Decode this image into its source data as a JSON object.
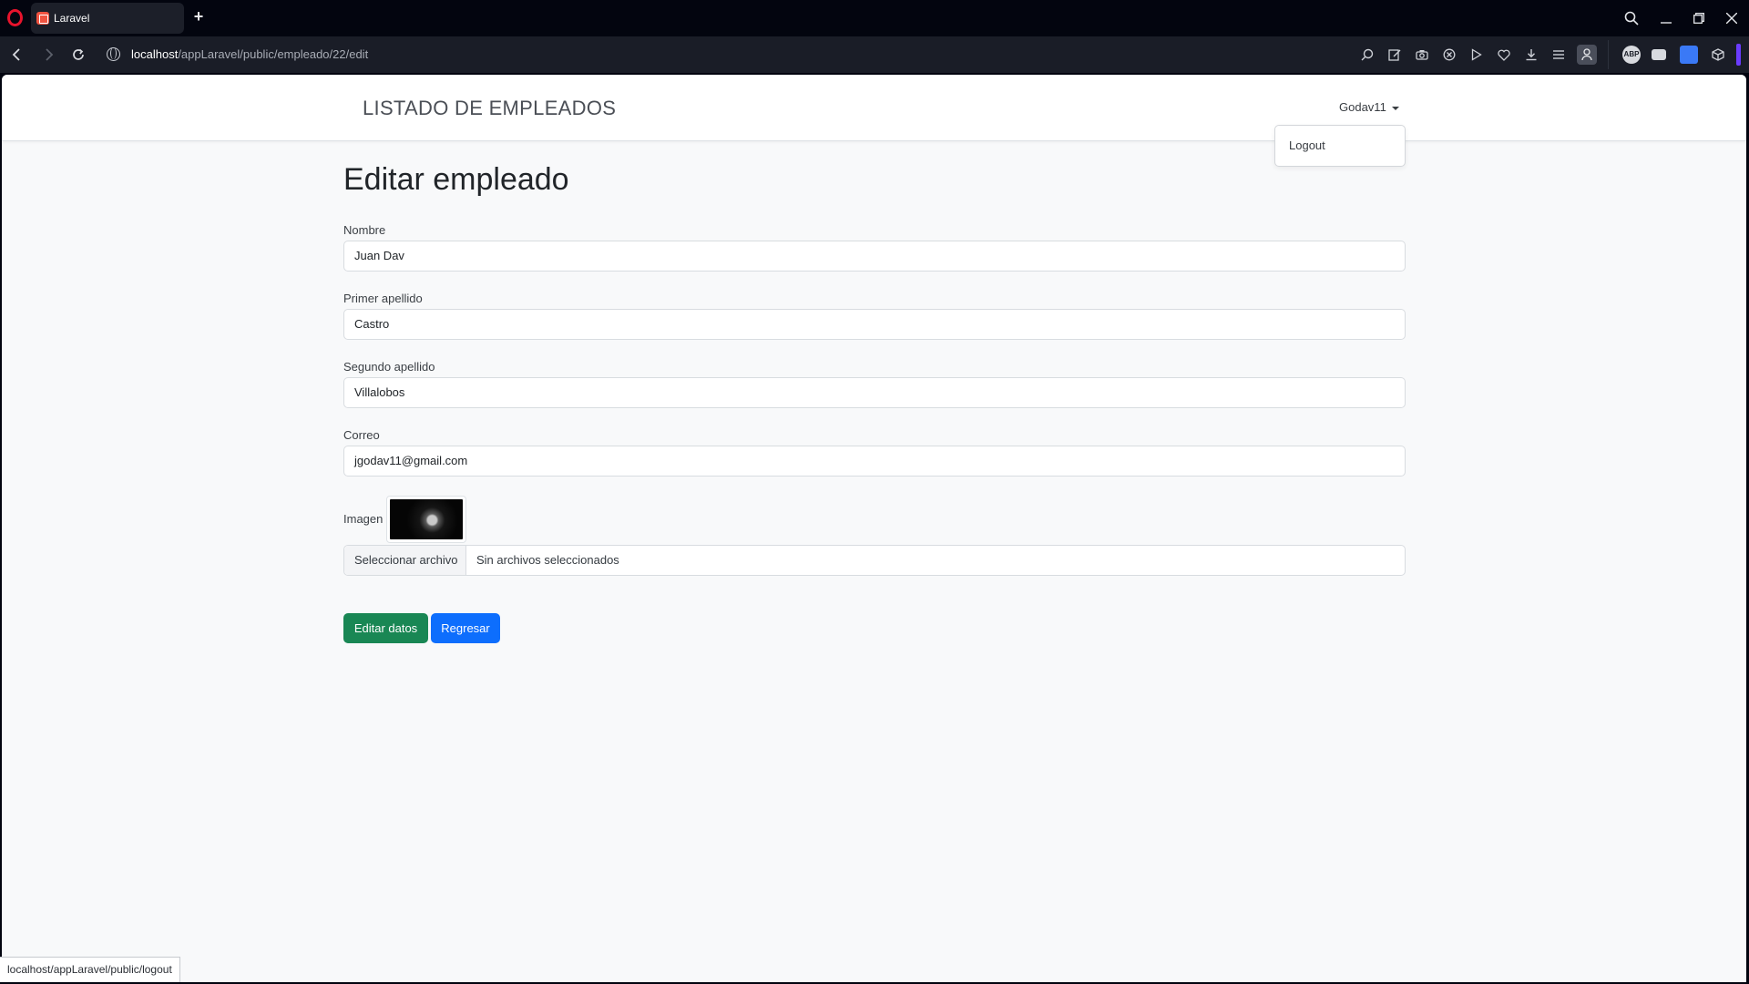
{
  "browser": {
    "tab_title": "Laravel",
    "new_tab_symbol": "+",
    "url_host": "localhost",
    "url_path": "/appLaravel/public/empleado/22/edit",
    "status_url": "localhost/appLaravel/public/logout",
    "accent_color": "#6b3cff",
    "brand_color": "#e8132c"
  },
  "navbar": {
    "brand": "LISTADO DE EMPLEADOS",
    "user": "Godav11",
    "dropdown_item": "Logout"
  },
  "form": {
    "title": "Editar empleado",
    "nombre_label": "Nombre",
    "nombre_value": "Juan Dav",
    "primer_label": "Primer apellido",
    "primer_value": "Castro",
    "segundo_label": "Segundo apellido",
    "segundo_value": "Villalobos",
    "correo_label": "Correo",
    "correo_value": "jgodav11@gmail.com",
    "imagen_label": "Imagen",
    "file_button": "Seleccionar archivo",
    "file_status": "Sin archivos seleccionados",
    "submit_label": "Editar datos",
    "back_label": "Regresar",
    "submit_color": "#198754",
    "back_color": "#0d6efd"
  }
}
